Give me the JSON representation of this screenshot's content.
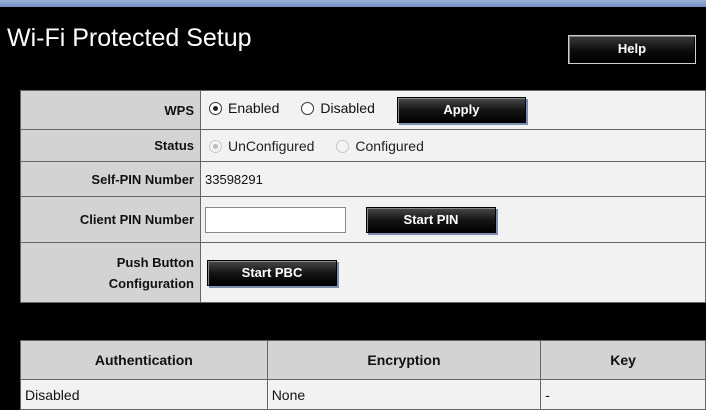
{
  "header": {
    "title": "Wi-Fi Protected Setup",
    "help_label": "Help"
  },
  "form": {
    "wps": {
      "label": "WPS",
      "options": [
        "Enabled",
        "Disabled"
      ],
      "selected": "Enabled",
      "apply_label": "Apply"
    },
    "status": {
      "label": "Status",
      "options": [
        "UnConfigured",
        "Configured"
      ],
      "selected": "UnConfigured"
    },
    "self_pin": {
      "label": "Self-PIN Number",
      "value": "33598291"
    },
    "client_pin": {
      "label": "Client PIN Number",
      "value": "",
      "button_label": "Start PIN"
    },
    "push_button": {
      "label_line1": "Push Button",
      "label_line2": "Configuration",
      "button_label": "Start PBC"
    }
  },
  "security_table": {
    "columns": [
      "Authentication",
      "Encryption",
      "Key"
    ],
    "rows": [
      [
        "Disabled",
        "None",
        "-"
      ]
    ]
  }
}
